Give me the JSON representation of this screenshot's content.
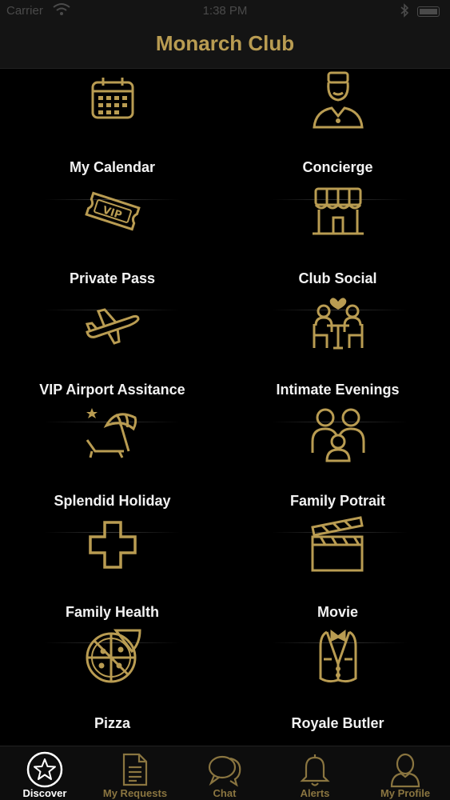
{
  "status_bar": {
    "carrier": "Carrier",
    "time": "1:38 PM"
  },
  "header": {
    "title": "Monarch Club"
  },
  "tiles": [
    {
      "label": "My Calendar",
      "icon": "calendar-icon"
    },
    {
      "label": "Concierge",
      "icon": "concierge-icon"
    },
    {
      "label": "Private Pass",
      "icon": "vip-ticket-icon"
    },
    {
      "label": "Club Social",
      "icon": "storefront-icon"
    },
    {
      "label": "VIP Airport Assitance",
      "icon": "airplane-icon"
    },
    {
      "label": "Intimate Evenings",
      "icon": "couple-dinner-icon"
    },
    {
      "label": "Splendid Holiday",
      "icon": "beach-umbrella-icon"
    },
    {
      "label": "Family Potrait",
      "icon": "family-icon"
    },
    {
      "label": "Family Health",
      "icon": "medical-cross-icon"
    },
    {
      "label": "Movie",
      "icon": "clapperboard-icon"
    },
    {
      "label": "Pizza",
      "icon": "pizza-icon"
    },
    {
      "label": "Royale Butler",
      "icon": "butler-vest-icon"
    }
  ],
  "tabs": [
    {
      "label": "Discover",
      "icon": "star-icon",
      "active": true
    },
    {
      "label": "My Requests",
      "icon": "document-icon",
      "active": false
    },
    {
      "label": "Chat",
      "icon": "chat-bubbles-icon",
      "active": false
    },
    {
      "label": "Alerts",
      "icon": "bell-icon",
      "active": false
    },
    {
      "label": "My Profile",
      "icon": "profile-icon",
      "active": false
    }
  ],
  "colors": {
    "accent": "#b99c52",
    "background": "#000000",
    "bar": "#141414",
    "tab_inactive": "#8a7540"
  }
}
